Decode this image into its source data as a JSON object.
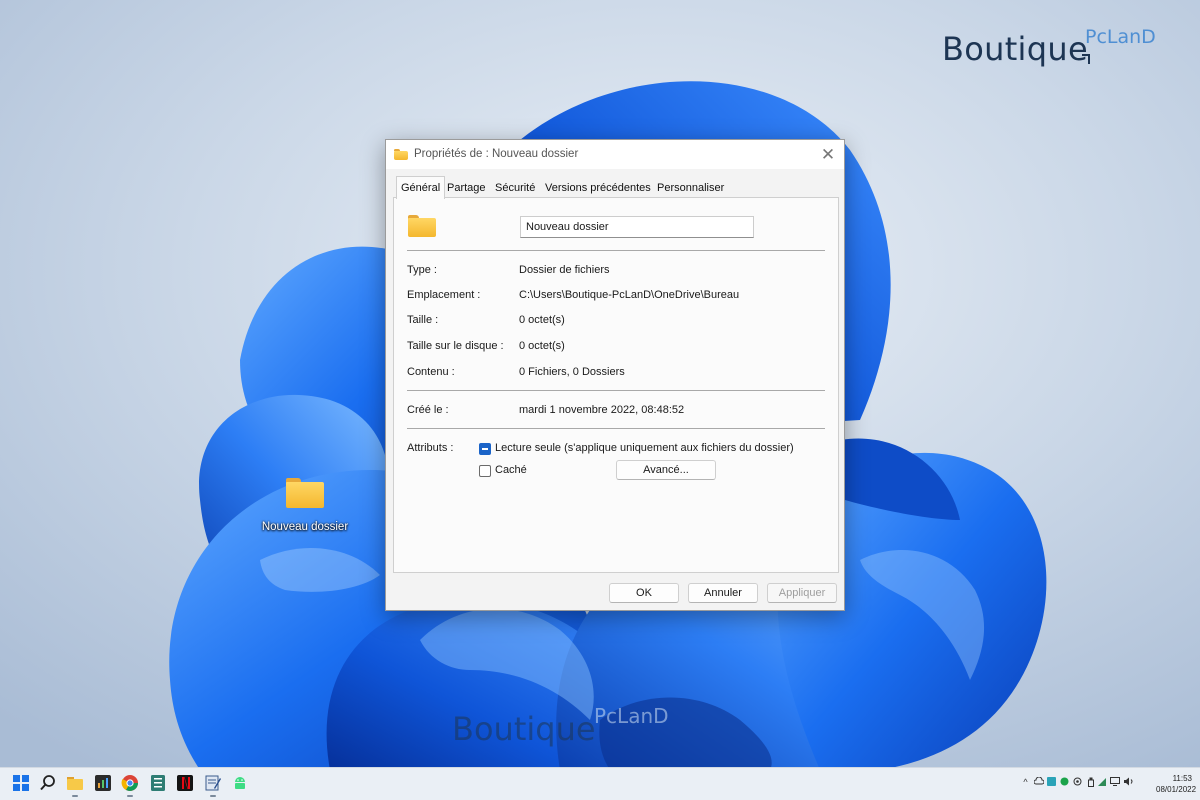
{
  "watermark": {
    "word1": "Boutique",
    "word2": "PcLanD"
  },
  "desktop": {
    "icon_label": "Nouveau dossier"
  },
  "dialog": {
    "title": "Propriétés de : Nouveau dossier",
    "close_glyph": "✕",
    "tabs": [
      {
        "label": "Général",
        "active": true
      },
      {
        "label": "Partage"
      },
      {
        "label": "Sécurité"
      },
      {
        "label": "Versions précédentes"
      },
      {
        "label": "Personnaliser"
      }
    ],
    "name_value": "Nouveau dossier",
    "properties": {
      "type": {
        "label": "Type :",
        "value": "Dossier de fichiers"
      },
      "location": {
        "label": "Emplacement :",
        "value": "C:\\Users\\Boutique-PcLanD\\OneDrive\\Bureau"
      },
      "size": {
        "label": "Taille :",
        "value": "0 octet(s)"
      },
      "size_on_disk": {
        "label": "Taille sur le disque :",
        "value": "0 octet(s)"
      },
      "contents": {
        "label": "Contenu :",
        "value": "0 Fichiers, 0 Dossiers"
      },
      "created": {
        "label": "Créé le :",
        "value": "mardi 1 novembre 2022, 08:48:52"
      }
    },
    "attributes": {
      "label": "Attributs :",
      "read_only": {
        "label": "Lecture seule (s'applique uniquement aux fichiers du dossier)",
        "state": "indeterminate"
      },
      "hidden": {
        "label": "Caché",
        "state": "unchecked"
      },
      "advanced_button": "Avancé..."
    },
    "buttons": {
      "ok": "OK",
      "cancel": "Annuler",
      "apply": "Appliquer"
    }
  },
  "taskbar": {
    "apps": [
      "start-icon",
      "search-icon",
      "file-explorer-icon",
      "task-manager-icon",
      "chrome-icon",
      "notes-app-icon",
      "netflix-icon",
      "editor-app-icon",
      "android-app-icon"
    ],
    "clock": {
      "time": "11:53",
      "date": "08/01/2022"
    }
  }
}
